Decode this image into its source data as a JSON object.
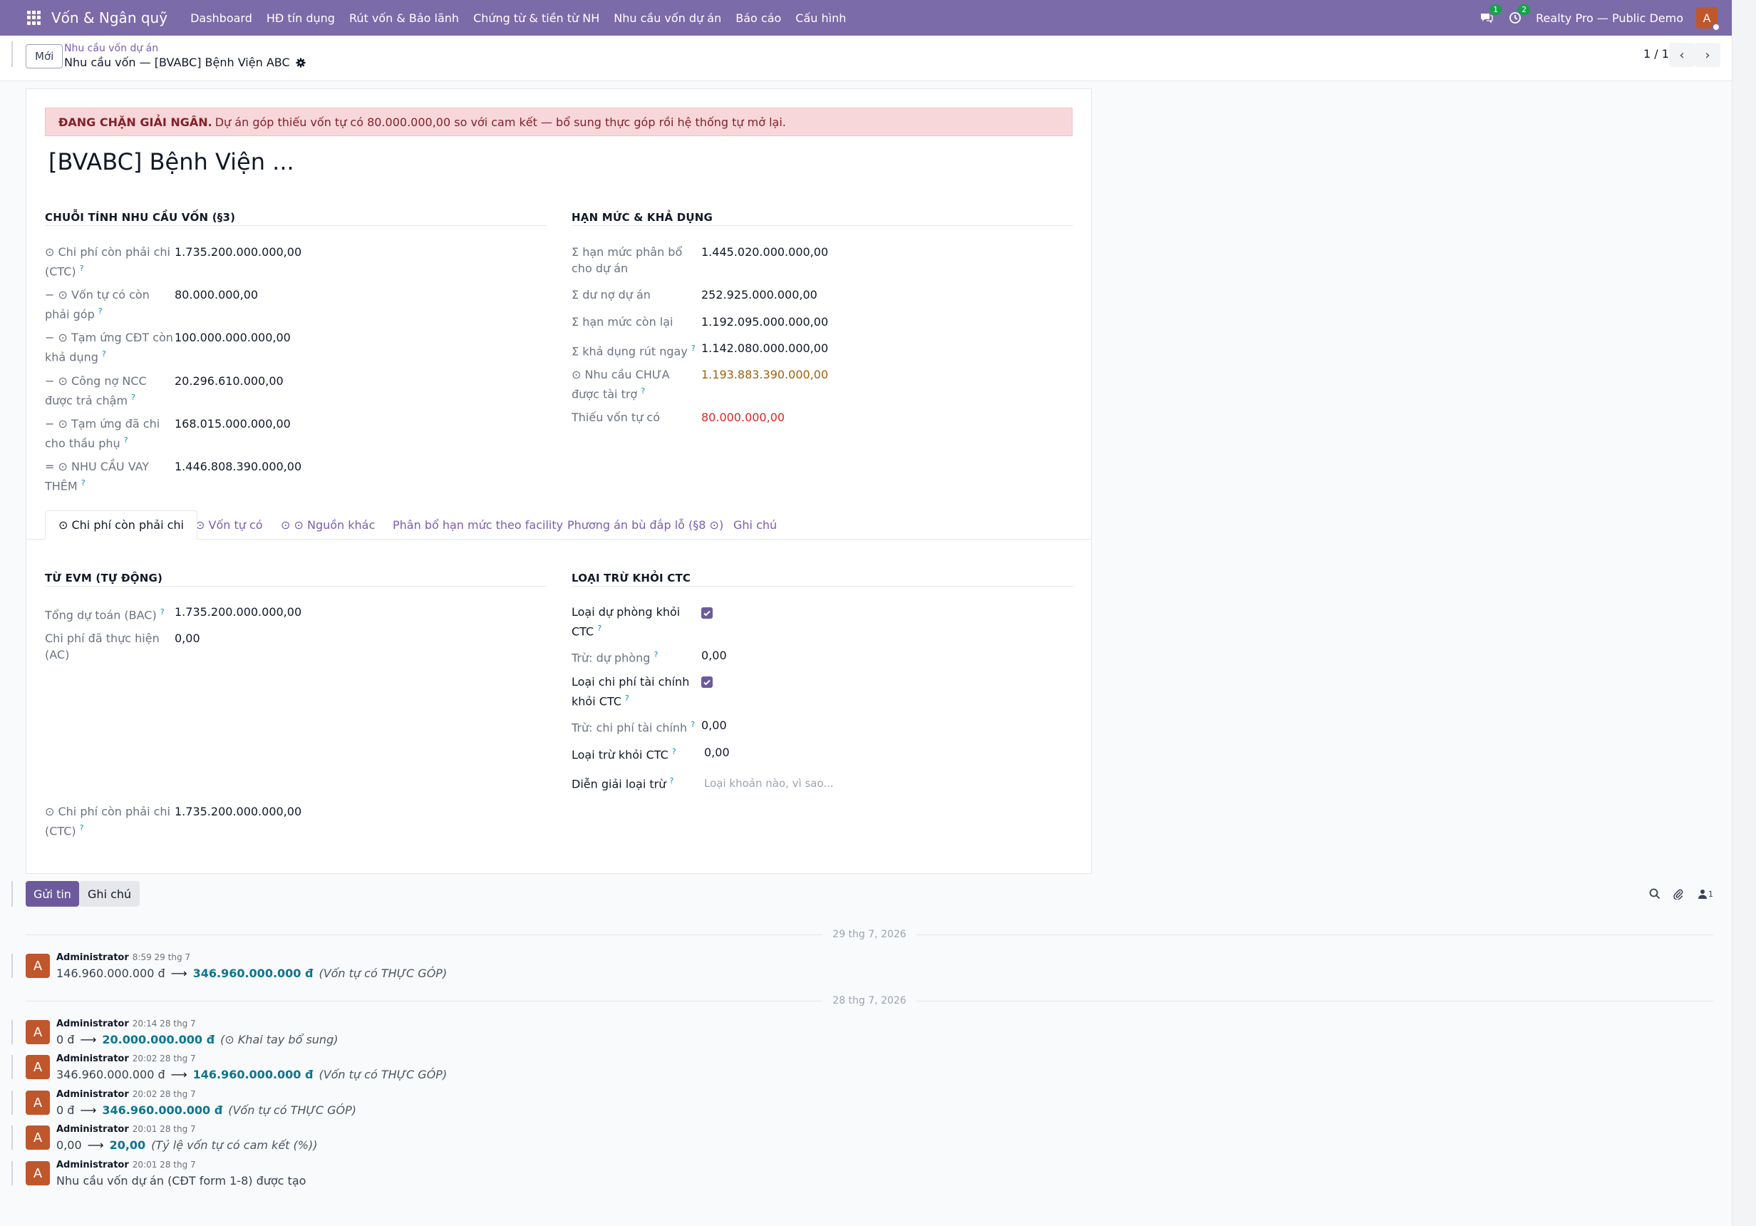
{
  "navbar": {
    "app_title": "Vốn & Ngân quỹ",
    "menu": [
      "Dashboard",
      "HĐ tín dụng",
      "Rút vốn & Bảo lãnh",
      "Chứng từ & tiền từ NH",
      "Nhu cầu vốn dự án",
      "Báo cáo",
      "Cấu hình"
    ],
    "messages_badge": "1",
    "activities_badge": "2",
    "company": "Realty Pro — Public Demo",
    "avatar_letter": "A"
  },
  "control": {
    "new_label": "Mới",
    "breadcrumb_parent": "Nhu cầu vốn dự án",
    "breadcrumb_current": "Nhu cầu vốn — [BVABC] Bệnh Viện ABC",
    "pager": "1 / 1"
  },
  "alert": {
    "strong": "ĐANG CHẶN GIẢI NGÂN.",
    "text": "Dự án góp thiếu vốn tự có 80.000.000,00 so với cam kết — bổ sung thực góp rồi hệ thống tự mở lại."
  },
  "record_title": "[BVABC] Bệnh Viện ...",
  "chain": {
    "title": "CHUỖI TÍNH NHU CẦU VỐN (§3)",
    "rows": [
      {
        "label": "⊙ Chi phí còn phải chi (CTC)",
        "value": "1.735.200.000.000,00"
      },
      {
        "label": "− ⊙ Vốn tự có còn phải góp",
        "value": "80.000.000,00"
      },
      {
        "label": "− ⊙ Tạm ứng CĐT còn khả dụng",
        "value": "100.000.000.000,00"
      },
      {
        "label": "− ⊙ Công nợ NCC được trả chậm",
        "value": "20.296.610.000,00"
      },
      {
        "label": "− ⊙ Tạm ứng đã chi cho thầu phụ",
        "value": "168.015.000.000,00"
      },
      {
        "label": "= ⊙ NHU CẦU VAY THÊM",
        "value": "1.446.808.390.000,00"
      }
    ]
  },
  "limits": {
    "title": "HẠN MỨC & KHẢ DỤNG",
    "rows": [
      {
        "label": "Σ hạn mức phân bổ cho dự án",
        "value": "1.445.020.000.000,00"
      },
      {
        "label": "Σ dư nợ dự án",
        "value": "252.925.000.000,00"
      },
      {
        "label": "Σ hạn mức còn lại",
        "value": "1.192.095.000.000,00"
      },
      {
        "label": "Σ khả dụng rút ngay",
        "value": "1.142.080.000.000,00"
      },
      {
        "label": "⊙ Nhu cầu CHƯA được tài trợ",
        "value": "1.193.883.390.000,00"
      },
      {
        "label": "Thiếu vốn tự có",
        "value": "80.000.000,00"
      }
    ]
  },
  "tabs": [
    "⊙ Chi phí còn phải chi",
    "⊙ Vốn tự có",
    "⊙ ⊙ Nguồn khác",
    "Phân bổ hạn mức theo facility",
    "Phương án bù đắp lỗ (§8 ⊙)",
    "Ghi chú"
  ],
  "evm": {
    "title": "TỪ EVM (TỰ ĐỘNG)",
    "bac_label": "Tổng dự toán (BAC)",
    "bac_value": "1.735.200.000.000,00",
    "ac_label": "Chi phí đã thực hiện (AC)",
    "ac_value": "0,00",
    "ctc_label": "⊙ Chi phí còn phải chi (CTC)",
    "ctc_value": "1.735.200.000.000,00"
  },
  "exclude": {
    "title": "LOẠI TRỪ KHỎI CTC",
    "contingency_label": "Loại dự phòng khỏi CTC",
    "contingency_checked": true,
    "minus_contingency_label": "Trừ: dự phòng",
    "minus_contingency_value": "0,00",
    "finance_label": "Loại chi phí tài chính khỏi CTC",
    "finance_checked": true,
    "minus_finance_label": "Trừ: chi phí tài chính",
    "minus_finance_value": "0,00",
    "exclude_label": "Loại trừ khỏi CTC",
    "exclude_value": "0,00",
    "explain_label": "Diễn giải loại trừ",
    "explain_placeholder": "Loại khoản nào, vì sao..."
  },
  "chatter": {
    "send_label": "Gửi tin",
    "note_label": "Ghi chú",
    "followers_count": "1",
    "dates": [
      "29 thg 7, 2026",
      "28 thg 7, 2026"
    ],
    "messages": [
      {
        "author": "Administrator",
        "time": "8:59 29 thg 7",
        "old": "146.960.000.000 đ",
        "new": "346.960.000.000 đ",
        "field": "(Vốn tự có THỰC GÓP)"
      },
      {
        "author": "Administrator",
        "time": "20:14 28 thg 7",
        "old": "0 đ",
        "new": "20.000.000.000 đ",
        "field": "(⊙ Khai tay bổ sung)"
      },
      {
        "author": "Administrator",
        "time": "20:02 28 thg 7",
        "old": "346.960.000.000 đ",
        "new": "146.960.000.000 đ",
        "field": "(Vốn tự có THỰC GÓP)"
      },
      {
        "author": "Administrator",
        "time": "20:02 28 thg 7",
        "old": "0 đ",
        "new": "346.960.000.000 đ",
        "field": "(Vốn tự có THỰC GÓP)"
      },
      {
        "author": "Administrator",
        "time": "20:01 28 thg 7",
        "old": "0,00",
        "new": "20,00",
        "field": "(Tỷ lệ vốn tự có cam kết (%))"
      },
      {
        "author": "Administrator",
        "time": "20:01 28 thg 7",
        "text": "Nhu cầu vốn dự án (CĐT form 1-8) được tạo"
      }
    ]
  },
  "colors": {
    "brand": "#7b6ba8",
    "primary": "#6c5a9c",
    "avatar": "#c0562b",
    "danger": "#dc2626",
    "warning": "#a16207"
  }
}
